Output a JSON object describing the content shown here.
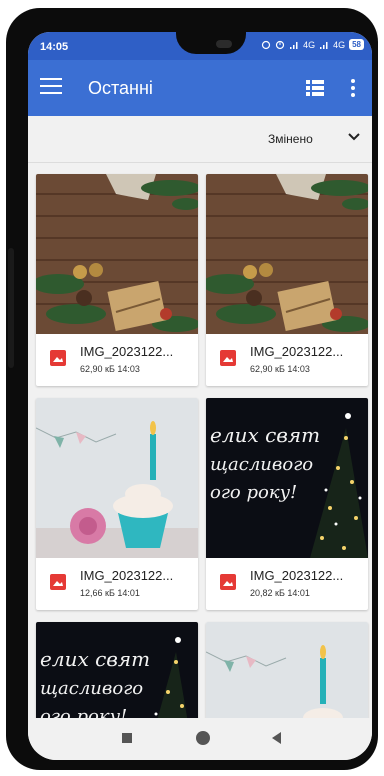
{
  "status": {
    "time": "14:05",
    "network": "4G",
    "battery": "58"
  },
  "appbar": {
    "title": "Останні"
  },
  "sort": {
    "label": "Змінено"
  },
  "files": [
    {
      "name": "IMG_2023122...",
      "info": "62,90 кБ 14:03"
    },
    {
      "name": "IMG_2023122...",
      "info": "62,90 кБ 14:03"
    },
    {
      "name": "IMG_2023122...",
      "info": "12,66 кБ 14:01"
    },
    {
      "name": "IMG_2023122...",
      "info": "20,82 кБ 14:01"
    }
  ],
  "thumb_text": {
    "line1": "елих свят",
    "line2": "щасливого",
    "line3": "ого року!"
  },
  "colors": {
    "status_bar": "#2f5fc6",
    "app_bar": "#3b6fd3",
    "image_icon": "#e53935"
  }
}
